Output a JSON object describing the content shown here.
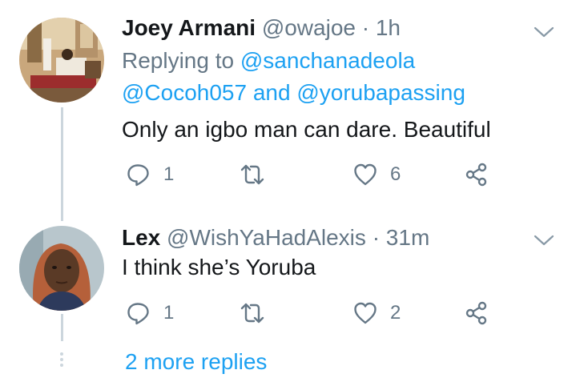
{
  "tweets": [
    {
      "name": "Joey Armani",
      "handle": "@owajoe",
      "separator": "·",
      "time": "1h",
      "replying_prefix": "Replying to",
      "mention_1": "@sanchanadeola",
      "mention_2": "@Cocoh057",
      "mention_joiner": "and",
      "mention_3": "@yorubapassing",
      "text": "Only an igbo man can dare. Beautiful",
      "replies": "1",
      "retweets": "",
      "likes": "6",
      "avatar_icon": "profile-photo-interior-room"
    },
    {
      "name": "Lex",
      "handle": "@WishYaHadAlexis",
      "separator": "·",
      "time": "31m",
      "text": "I think she’s Yoruba",
      "replies": "1",
      "retweets": "",
      "likes": "2",
      "avatar_icon": "profile-photo-woman"
    }
  ],
  "more_replies": "2 more replies",
  "colors": {
    "link": "#1da1f2",
    "muted": "#657786",
    "text": "#14171a",
    "thread_line": "#ccd6dd"
  }
}
